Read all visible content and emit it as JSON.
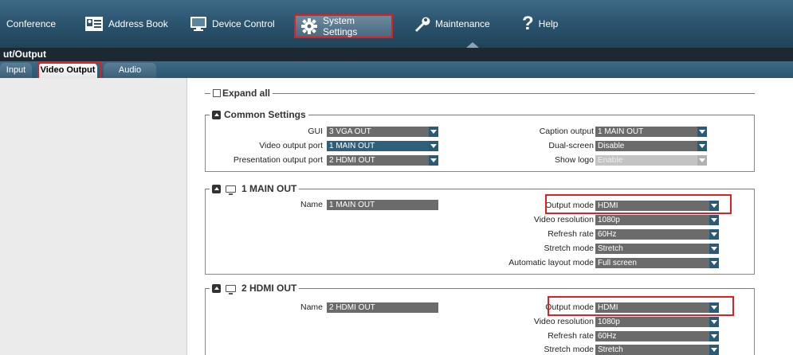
{
  "nav": {
    "items": [
      {
        "label": "Conference"
      },
      {
        "label": "Address Book"
      },
      {
        "label": "Device Control"
      },
      {
        "label": "System Settings"
      },
      {
        "label": "Maintenance"
      },
      {
        "label": "Help"
      }
    ],
    "selected": "System Settings"
  },
  "page": {
    "title": "ut/Output"
  },
  "tabs": [
    {
      "label": "Input"
    },
    {
      "label": "Video Output"
    },
    {
      "label": "Audio"
    }
  ],
  "expand_all": {
    "label": "Expand all",
    "checked": false
  },
  "common": {
    "title": "Common Settings",
    "gui_label": "GUI",
    "gui_value": "3 VGA OUT",
    "video_port_label": "Video output port",
    "video_port_value": "1 MAIN OUT",
    "presentation_label": "Presentation output port",
    "presentation_value": "2 HDMI OUT",
    "caption_label": "Caption output",
    "caption_value": "1 MAIN OUT",
    "dual_label": "Dual-screen",
    "dual_value": "Disable",
    "logo_label": "Show logo",
    "logo_value": "Enable"
  },
  "main_out": {
    "title": "1 MAIN OUT",
    "name_label": "Name",
    "name_value": "1 MAIN OUT",
    "output_mode_label": "Output mode",
    "output_mode_value": "HDMI",
    "resolution_label": "Video resolution",
    "resolution_value": "1080p",
    "refresh_label": "Refresh rate",
    "refresh_value": "60Hz",
    "stretch_label": "Stretch mode",
    "stretch_value": "Stretch",
    "layout_label": "Automatic layout mode",
    "layout_value": "Full screen"
  },
  "hdmi_out": {
    "title": "2 HDMI OUT",
    "name_label": "Name",
    "name_value": "2 HDMI OUT",
    "output_mode_label": "Output mode",
    "output_mode_value": "HDMI",
    "resolution_label": "Video resolution",
    "resolution_value": "1080p",
    "refresh_label": "Refresh rate",
    "refresh_value": "60Hz",
    "stretch_label": "Stretch mode",
    "stretch_value": "Stretch"
  },
  "colors": {
    "nav_bg": "#2c5570",
    "highlight": "#e02020",
    "select_bg": "#6b6b6b",
    "select_active": "#2f5f7a"
  }
}
